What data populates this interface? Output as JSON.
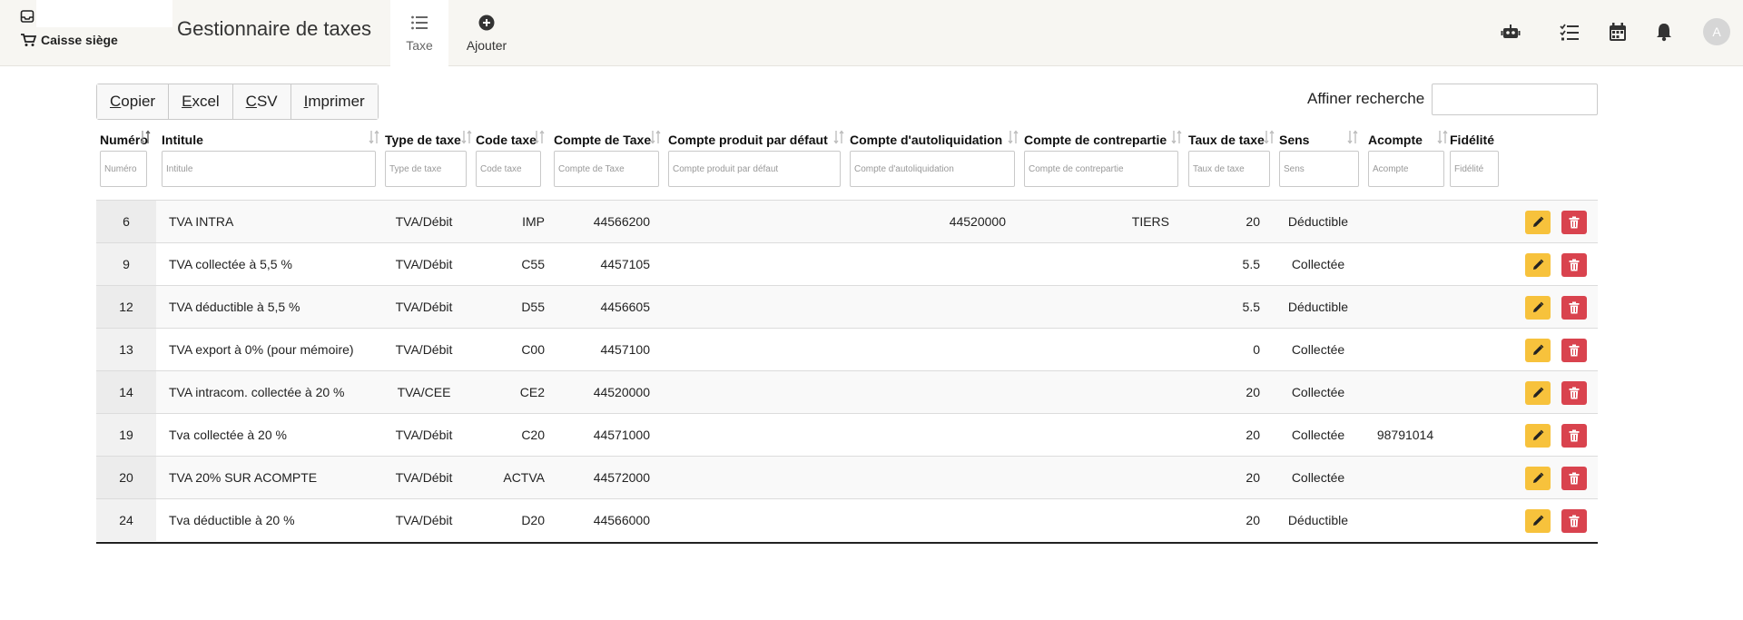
{
  "header": {
    "store_name": "Caisse siège",
    "app_title": "Gestionnaire de taxes",
    "tabs": [
      {
        "label": "Taxe"
      },
      {
        "label": "Ajouter"
      }
    ],
    "avatar_initial": "A"
  },
  "toolbar": {
    "buttons": [
      {
        "first": "C",
        "rest": "opier"
      },
      {
        "first": "E",
        "rest": "xcel"
      },
      {
        "first": "C",
        "rest": "SV"
      },
      {
        "first": "I",
        "rest": "mprimer"
      }
    ],
    "search_label": "Affiner recherche",
    "search_value": ""
  },
  "table": {
    "columns": [
      {
        "label": "Numéro",
        "placeholder": "Numéro"
      },
      {
        "label": "Intitule",
        "placeholder": "Intitule"
      },
      {
        "label": "Type de taxe",
        "placeholder": "Type de taxe"
      },
      {
        "label": "Code taxe",
        "placeholder": "Code taxe"
      },
      {
        "label": "Compte de Taxe",
        "placeholder": "Compte de Taxe"
      },
      {
        "label": "Compte produit par défaut",
        "placeholder": "Compte produit par défaut"
      },
      {
        "label": "Compte d'autoliquidation",
        "placeholder": "Compte d'autoliquidation"
      },
      {
        "label": "Compte de contrepartie",
        "placeholder": "Compte de contrepartie"
      },
      {
        "label": "Taux de taxe",
        "placeholder": "Taux de taxe"
      },
      {
        "label": "Sens",
        "placeholder": "Sens"
      },
      {
        "label": "Acompte",
        "placeholder": "Acompte"
      },
      {
        "label": "Fidélité",
        "placeholder": "Fidélité"
      }
    ],
    "rows": [
      {
        "num": "6",
        "intitule": "TVA INTRA",
        "type": "TVA/Débit",
        "code": "IMP",
        "compte": "44566200",
        "produit": "",
        "autoliq": "44520000",
        "contrepartie": "TIERS",
        "taux": "20",
        "sens": "Déductible",
        "acompte": "",
        "fidelite": ""
      },
      {
        "num": "9",
        "intitule": "TVA collectée à 5,5 %",
        "type": "TVA/Débit",
        "code": "C55",
        "compte": "4457105",
        "produit": "",
        "autoliq": "",
        "contrepartie": "",
        "taux": "5.5",
        "sens": "Collectée",
        "acompte": "",
        "fidelite": ""
      },
      {
        "num": "12",
        "intitule": "TVA déductible à 5,5 %",
        "type": "TVA/Débit",
        "code": "D55",
        "compte": "4456605",
        "produit": "",
        "autoliq": "",
        "contrepartie": "",
        "taux": "5.5",
        "sens": "Déductible",
        "acompte": "",
        "fidelite": ""
      },
      {
        "num": "13",
        "intitule": "TVA export à 0% (pour mémoire)",
        "type": "TVA/Débit",
        "code": "C00",
        "compte": "4457100",
        "produit": "",
        "autoliq": "",
        "contrepartie": "",
        "taux": "0",
        "sens": "Collectée",
        "acompte": "",
        "fidelite": ""
      },
      {
        "num": "14",
        "intitule": "TVA intracom. collectée à 20 %",
        "type": "TVA/CEE",
        "code": "CE2",
        "compte": "44520000",
        "produit": "",
        "autoliq": "",
        "contrepartie": "",
        "taux": "20",
        "sens": "Collectée",
        "acompte": "",
        "fidelite": ""
      },
      {
        "num": "19",
        "intitule": "Tva collectée à 20 %",
        "type": "TVA/Débit",
        "code": "C20",
        "compte": "44571000",
        "produit": "",
        "autoliq": "",
        "contrepartie": "",
        "taux": "20",
        "sens": "Collectée",
        "acompte": "98791014",
        "fidelite": ""
      },
      {
        "num": "20",
        "intitule": "TVA 20% SUR ACOMPTE",
        "type": "TVA/Débit",
        "code": "ACTVA",
        "compte": "44572000",
        "produit": "",
        "autoliq": "",
        "contrepartie": "",
        "taux": "20",
        "sens": "Collectée",
        "acompte": "",
        "fidelite": ""
      },
      {
        "num": "24",
        "intitule": "Tva déductible à 20 %",
        "type": "TVA/Débit",
        "code": "D20",
        "compte": "44566000",
        "produit": "",
        "autoliq": "",
        "contrepartie": "",
        "taux": "20",
        "sens": "Déductible",
        "acompte": "",
        "fidelite": ""
      }
    ]
  },
  "icons": {
    "inbox": "inbox-icon",
    "cart": "cart-icon",
    "list": "list-icon",
    "add": "plus-circle-icon",
    "robot": "robot-icon",
    "tasks": "checklist-icon",
    "calendar": "calendar-icon",
    "bell": "bell-icon",
    "edit": "pencil-icon",
    "delete": "trash-icon"
  },
  "colors": {
    "edit": "#f7c23c",
    "delete": "#d9434e",
    "topbar": "#f7f6f2"
  }
}
